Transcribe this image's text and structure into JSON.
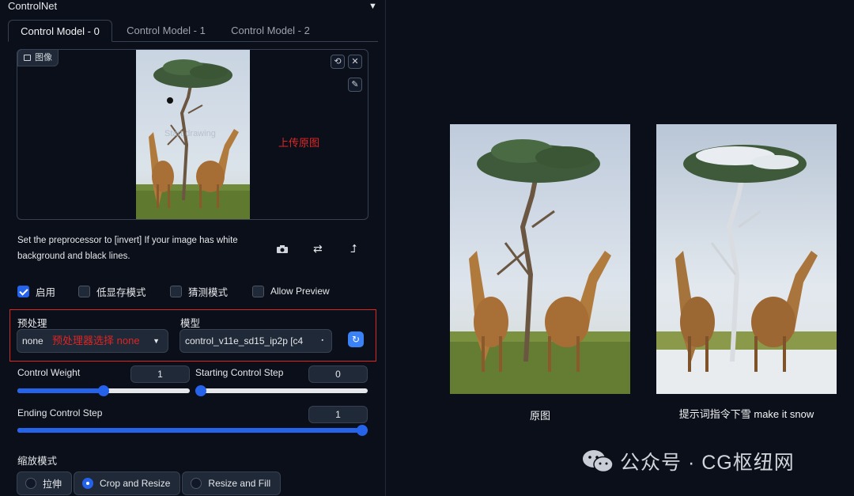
{
  "panel": {
    "title": "ControlNet",
    "collapse_glyph": "▼"
  },
  "tabs": [
    "Control Model - 0",
    "Control Model - 1",
    "Control Model - 2"
  ],
  "image_area": {
    "label": "图像",
    "overlay_text": "Start drawing",
    "annotation": "上传原图"
  },
  "hint": "Set the preprocessor to [invert] If your image has white background and black lines.",
  "checkboxes": [
    {
      "label": "启用",
      "checked": true
    },
    {
      "label": "低显存模式",
      "checked": false
    },
    {
      "label": "猜测模式",
      "checked": false
    },
    {
      "label": "Allow Preview",
      "checked": false
    }
  ],
  "preprocessor": {
    "label": "预处理",
    "value": "none",
    "annotation": "预处理器选择 none"
  },
  "model": {
    "label": "模型",
    "value": "control_v11e_sd15_ip2p [c4"
  },
  "sliders": {
    "control_weight": {
      "label": "Control Weight",
      "value": "1",
      "fraction": 0.5
    },
    "starting_step": {
      "label": "Starting Control Step",
      "value": "0",
      "fraction": 0.0
    },
    "ending_step": {
      "label": "Ending Control Step",
      "value": "1",
      "fraction": 1.0
    }
  },
  "resize_mode": {
    "label": "缩放模式",
    "options": [
      {
        "label": "拉伸",
        "selected": false
      },
      {
        "label": "Crop and Resize",
        "selected": true
      },
      {
        "label": "Resize and Fill",
        "selected": false
      }
    ]
  },
  "comparison": {
    "original_caption": "原图",
    "result_caption": "提示词指令下雪 make it snow"
  },
  "watermark": {
    "text": "公众号 · CG枢纽网"
  },
  "colors": {
    "accent": "#2563eb",
    "annotation_red": "#dc2626",
    "background": "#0b0f19"
  }
}
